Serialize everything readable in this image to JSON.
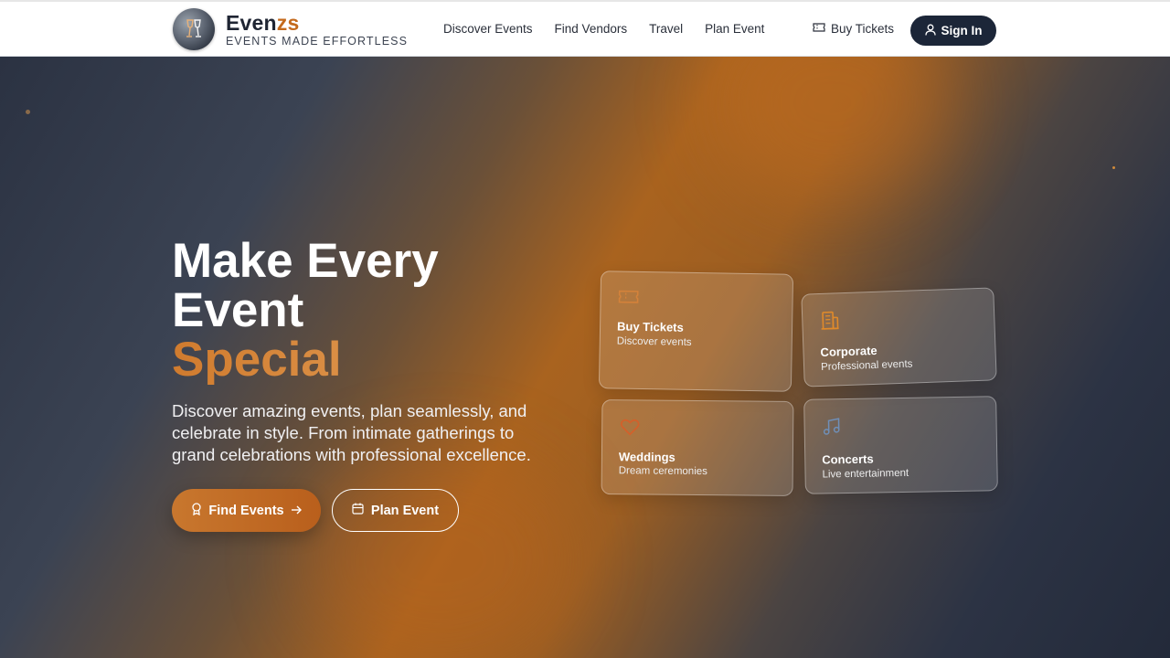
{
  "brand": {
    "name_main": "Even",
    "name_accent": "zs",
    "tagline": "EVENTS MADE EFFORTLESS"
  },
  "nav": {
    "items": [
      "Discover Events",
      "Find Vendors",
      "Travel",
      "Plan Event"
    ]
  },
  "header_actions": {
    "buy_tickets": "Buy Tickets",
    "sign_in": "Sign In"
  },
  "hero": {
    "headline_line1": "Make Every",
    "headline_line2": "Event",
    "headline_accent": "Special",
    "subtext": "Discover amazing events, plan seamlessly, and celebrate in style. From intimate gatherings to grand celebrations with professional excellence.",
    "primary_button": "Find Events",
    "secondary_button": "Plan Event"
  },
  "cards": [
    {
      "title": "Buy Tickets",
      "subtitle": "Discover events",
      "icon": "ticket-icon"
    },
    {
      "title": "Corporate",
      "subtitle": "Professional events",
      "icon": "building-icon"
    },
    {
      "title": "Weddings",
      "subtitle": "Dream ceremonies",
      "icon": "heart-icon"
    },
    {
      "title": "Concerts",
      "subtitle": "Live entertainment",
      "icon": "music-note-icon"
    }
  ],
  "colors": {
    "accent": "#c46a1c",
    "dark_navy": "#1c2638",
    "hero_base": "#2b3242"
  }
}
